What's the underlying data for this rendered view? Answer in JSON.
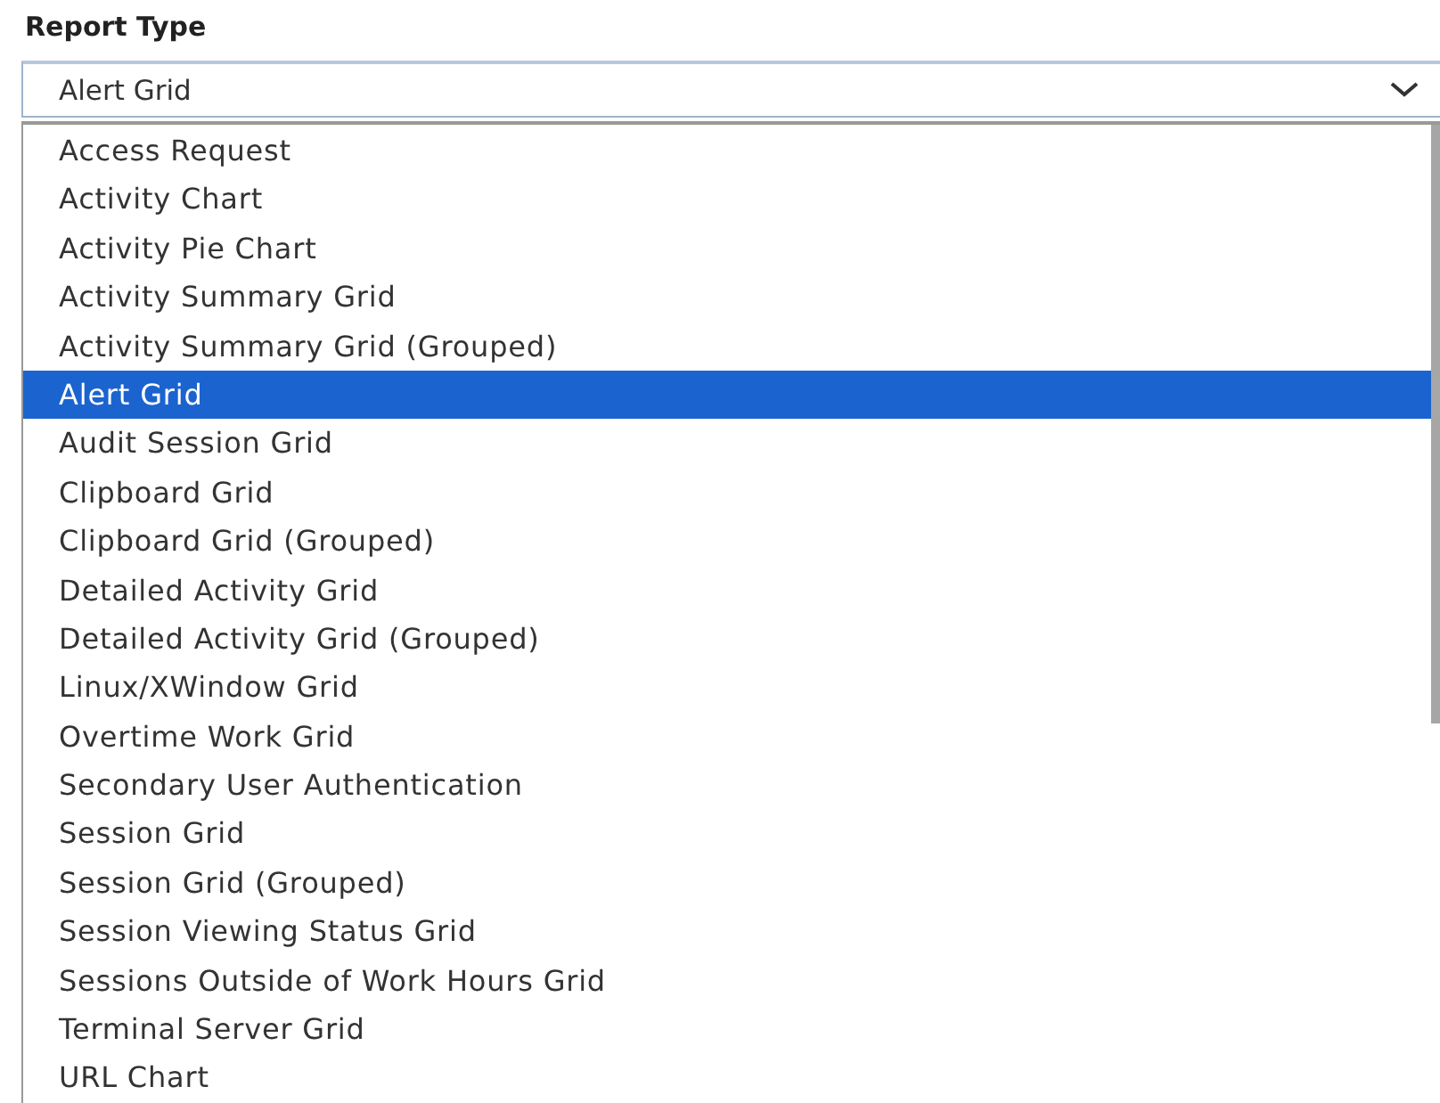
{
  "label": "Report Type",
  "select": {
    "value": "Alert Grid"
  },
  "options": [
    {
      "label": "Access Request",
      "selected": false
    },
    {
      "label": "Activity Chart",
      "selected": false
    },
    {
      "label": "Activity Pie Chart",
      "selected": false
    },
    {
      "label": "Activity Summary Grid",
      "selected": false
    },
    {
      "label": "Activity Summary Grid (Grouped)",
      "selected": false
    },
    {
      "label": "Alert Grid",
      "selected": true
    },
    {
      "label": "Audit Session Grid",
      "selected": false
    },
    {
      "label": "Clipboard Grid",
      "selected": false
    },
    {
      "label": "Clipboard Grid (Grouped)",
      "selected": false
    },
    {
      "label": "Detailed Activity Grid",
      "selected": false
    },
    {
      "label": "Detailed Activity Grid (Grouped)",
      "selected": false
    },
    {
      "label": "Linux/XWindow Grid",
      "selected": false
    },
    {
      "label": "Overtime Work Grid",
      "selected": false
    },
    {
      "label": "Secondary User Authentication",
      "selected": false
    },
    {
      "label": "Session Grid",
      "selected": false
    },
    {
      "label": "Session Grid (Grouped)",
      "selected": false
    },
    {
      "label": "Session Viewing Status Grid",
      "selected": false
    },
    {
      "label": "Sessions Outside of Work Hours Grid",
      "selected": false
    },
    {
      "label": "Terminal Server Grid",
      "selected": false
    },
    {
      "label": "URL Chart",
      "selected": false
    }
  ]
}
